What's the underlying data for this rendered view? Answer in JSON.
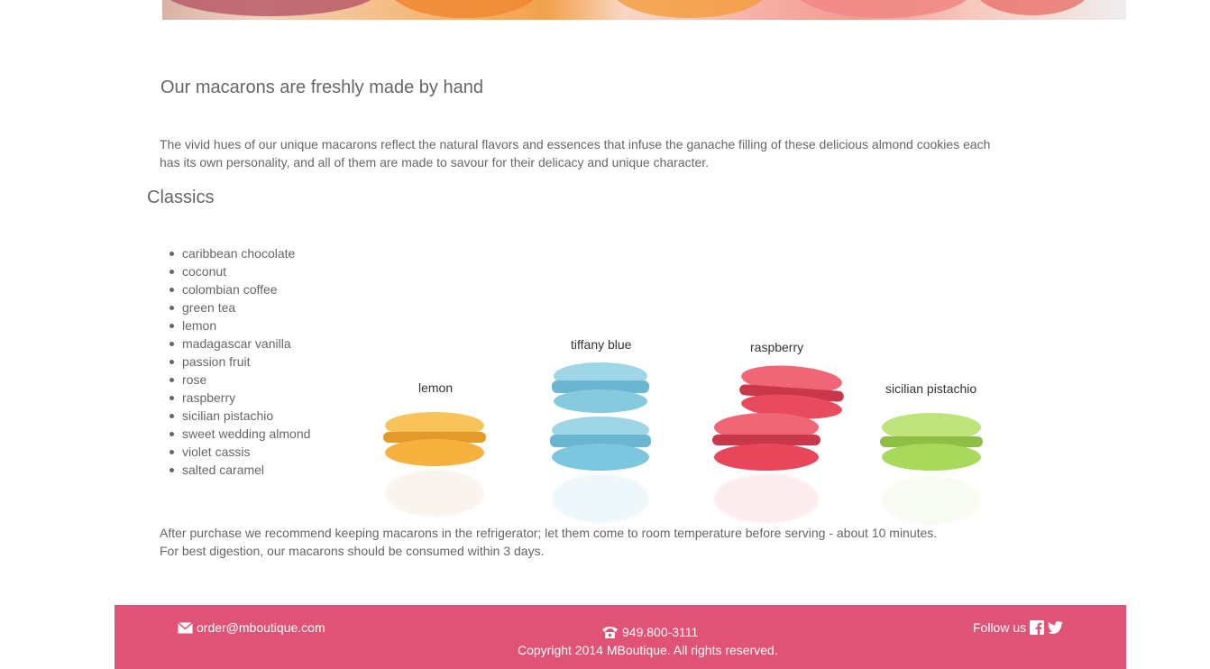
{
  "headline": "Our macarons are freshly made by hand",
  "intro": "The vivid hues of our unique macarons reflect the natural flavors and essences that infuse the ganache filling of these delicious almond cookies each has its own personality, and all of them are made to savour for their delicacy and unique character.",
  "classics": {
    "title": "Classics",
    "flavors": [
      "caribbean chocolate",
      "coconut",
      "colombian coffee",
      "green tea",
      "lemon",
      "madagascar vanilla",
      "passion fruit",
      "rose",
      "raspberry",
      "sicilian pistachio",
      "sweet wedding almond",
      "violet cassis",
      "salted caramel"
    ]
  },
  "display": {
    "lemon": "lemon",
    "tiffany": "tiffany blue",
    "raspberry": "raspberry",
    "pistachio": "sicilian pistachio"
  },
  "care": {
    "line1": "After purchase we recommend keeping macarons in the refrigerator; let them come to room temperature before serving - about 10 minutes.",
    "line2": "For best digestion, our macarons should be consumed within 3 days."
  },
  "footer": {
    "email": "order@mboutique.com",
    "phone": "949.800-3111",
    "copyright": "Copyright 2014 MBoutique. All rights reserved.",
    "follow": "Follow us",
    "icons": [
      "envelope-icon",
      "telephone-icon",
      "facebook-icon",
      "twitter-icon"
    ]
  },
  "colors": {
    "footer_bg": "#e05276",
    "text": "#666666",
    "lemon": "#f6b23e",
    "tiffany": "#7cc6df",
    "raspberry": "#e8475b",
    "pistachio": "#a9d95a"
  }
}
